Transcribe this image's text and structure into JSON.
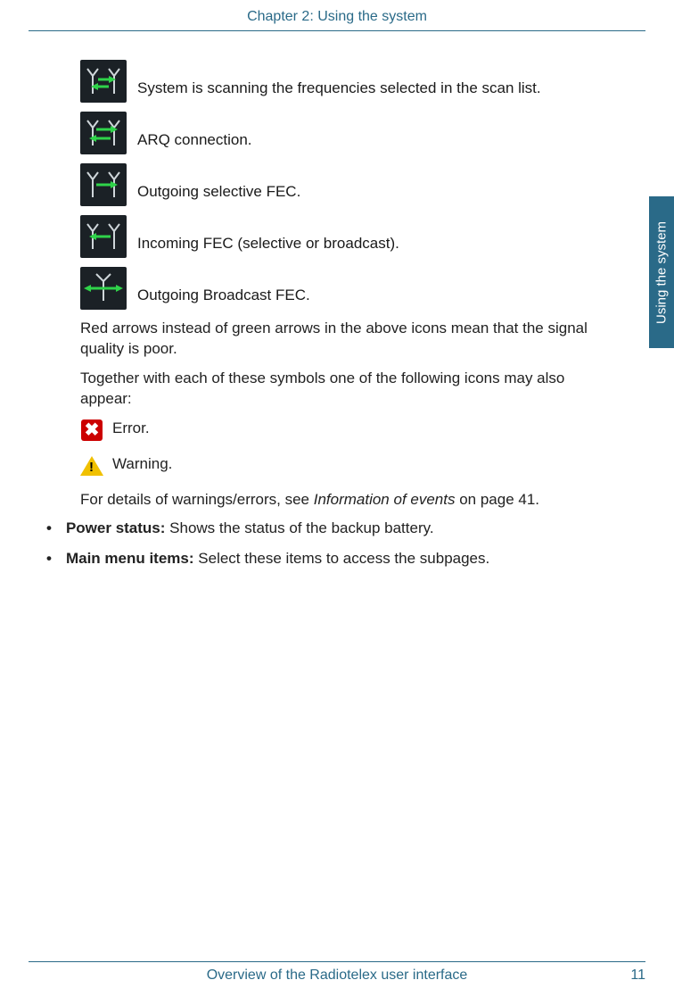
{
  "header": {
    "chapter": "Chapter 2:  Using the system"
  },
  "sideTab": {
    "label": "Using the system"
  },
  "icons": [
    {
      "id": "scanning-icon",
      "label": "System is scanning the frequencies selected in the scan list."
    },
    {
      "id": "arq-icon",
      "label": "ARQ connection."
    },
    {
      "id": "out-sel-fec-icon",
      "label": "Outgoing selective FEC."
    },
    {
      "id": "in-fec-icon",
      "label": "Incoming FEC (selective or broadcast)."
    },
    {
      "id": "out-bcast-fec-icon",
      "label": "Outgoing Broadcast FEC."
    }
  ],
  "paragraphs": {
    "redArrows": "Red arrows instead of green arrows in the above icons mean that the signal quality is poor.",
    "together": "Together with each of these symbols one of the following icons may also appear:",
    "details_pre": "For details of warnings/errors, see ",
    "details_ital": "Information of events",
    "details_post": " on page 41."
  },
  "statusIcons": {
    "error": "Error.",
    "warning": "Warning."
  },
  "bullets": [
    {
      "bold": "Power status:",
      "rest": " Shows the status of the backup battery."
    },
    {
      "bold": "Main menu items:",
      "rest": " Select these items to access the subpages."
    }
  ],
  "footer": {
    "section": "Overview of the Radiotelex user interface",
    "page": "11"
  }
}
